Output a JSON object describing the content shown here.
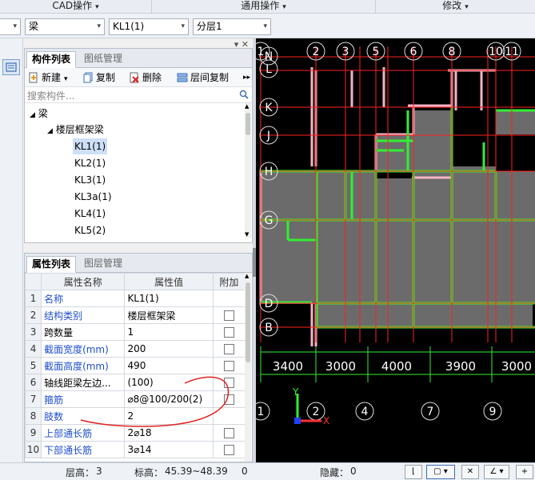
{
  "ribbon": {
    "groups": [
      {
        "label": "CAD操作"
      },
      {
        "label": "通用操作"
      },
      {
        "label": "修改"
      }
    ]
  },
  "selectors": {
    "element_type": "梁",
    "component": "KL1(1)",
    "layer": "分层1"
  },
  "component_panel": {
    "tabs": [
      "构件列表",
      "图纸管理"
    ],
    "active_tab": 0,
    "toolbar": {
      "new": "新建",
      "copy": "复制",
      "delete": "删除",
      "floor_copy": "层间复制",
      "more": "▸▸"
    },
    "search_placeholder": "搜索构件...",
    "tree": {
      "root": "梁",
      "group": "楼层框架梁",
      "items": [
        "KL1(1)",
        "KL2(1)",
        "KL3(1)",
        "KL3a(1)",
        "KL4(1)",
        "KL5(2)"
      ],
      "selected_index": 0
    }
  },
  "property_panel": {
    "tabs": [
      "属性列表",
      "图层管理"
    ],
    "active_tab": 0,
    "headers": [
      "属性名称",
      "属性值",
      "附加"
    ],
    "rows": [
      {
        "no": "1",
        "name": "名称",
        "value": "KL1(1)",
        "blue": true,
        "checkbox": false
      },
      {
        "no": "2",
        "name": "结构类别",
        "value": "楼层框架梁",
        "blue": true,
        "checkbox": true
      },
      {
        "no": "3",
        "name": "跨数量",
        "value": "1",
        "blue": false,
        "checkbox": true
      },
      {
        "no": "4",
        "name": "截面宽度(mm)",
        "value": "200",
        "blue": true,
        "checkbox": true
      },
      {
        "no": "5",
        "name": "截面高度(mm)",
        "value": "490",
        "blue": true,
        "checkbox": true
      },
      {
        "no": "6",
        "name": "轴线距梁左边...",
        "value": "(100)",
        "blue": false,
        "checkbox": true
      },
      {
        "no": "7",
        "name": "箍筋",
        "value": "⌀8@100/200(2)",
        "blue": true,
        "checkbox": true
      },
      {
        "no": "8",
        "name": "肢数",
        "value": "2",
        "blue": true,
        "checkbox": false
      },
      {
        "no": "9",
        "name": "上部通长筋",
        "value": "2⌀18",
        "blue": true,
        "checkbox": true
      },
      {
        "no": "10",
        "name": "下部通长筋",
        "value": "3⌀14",
        "blue": true,
        "checkbox": true
      }
    ]
  },
  "cad": {
    "top_axes": [
      "1",
      "2",
      "3",
      "5",
      "6",
      "8",
      "10",
      "11"
    ],
    "left_axes": [
      "N",
      "L",
      "K",
      "J",
      "H",
      "G",
      "D",
      "B"
    ],
    "dimensions": [
      "3400",
      "3000",
      "4000",
      "3900",
      "3000"
    ],
    "bottom_axes": [
      "1",
      "2",
      "4",
      "7",
      "9"
    ],
    "ucs": {
      "x": "X",
      "y": "Y"
    }
  },
  "status": {
    "floor_label": "层高：",
    "floor_value": "3",
    "elev_label": "标高：",
    "elev_value": "45.39~48.39",
    "zero": "0",
    "hidden_label": "隐藏：",
    "hidden_value": "0"
  },
  "colors": {
    "cad_bg": "#000000",
    "axis_red": "#ff2020",
    "beam_green": "#33ee33",
    "beam_pink": "#f6b3c3",
    "slab_gray": "#6b6b6b",
    "dim_text": "#ffffff",
    "link_blue": "#1f4fcf"
  }
}
